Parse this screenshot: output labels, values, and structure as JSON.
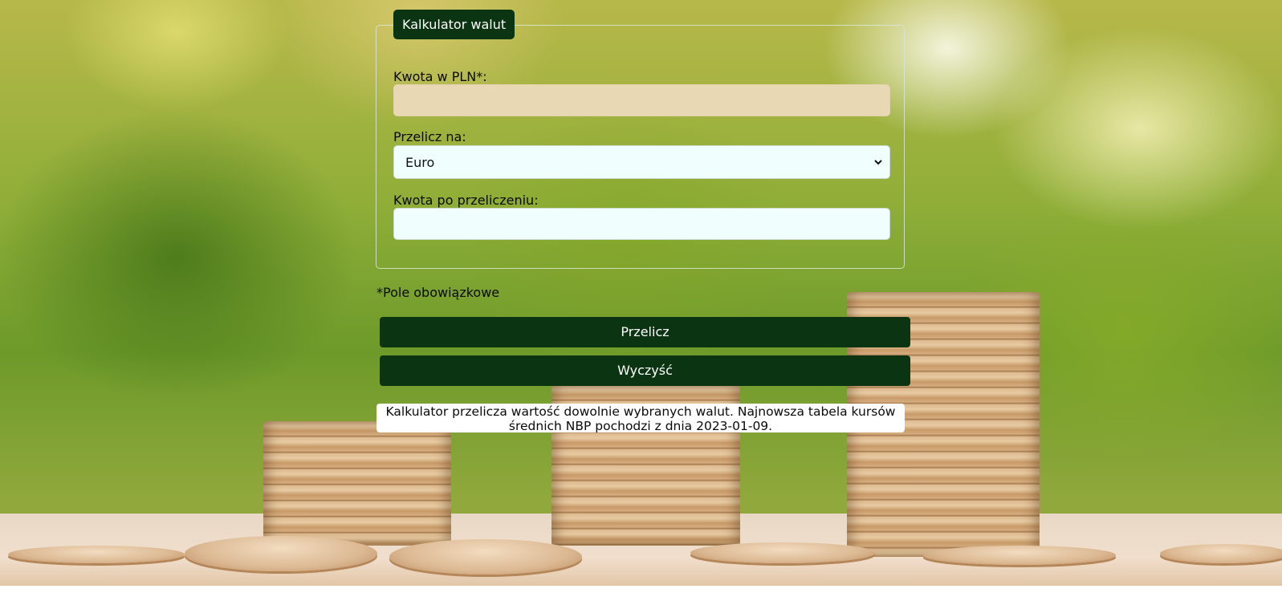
{
  "form": {
    "legend": "Kalkulator walut",
    "amount_label": "Kwota w PLN*:",
    "amount_value": "",
    "target_label": "Przelicz na:",
    "target_selected": "Euro",
    "result_label": "Kwota po przeliczeniu:",
    "result_value": ""
  },
  "required_note": "*Pole obowiązkowe",
  "buttons": {
    "convert": "Przelicz",
    "clear": "Wyczyść"
  },
  "info": {
    "line1": "Kalkulator przelicza wartość dowolnie wybranych walut. Najnowsza tabela kursów",
    "line2": "średnich NBP pochodzi z dnia 2023-01-09."
  },
  "icons": {
    "select_arrow": "chevron-down-icon"
  },
  "colors": {
    "accent": "#0b3512",
    "amount_field": "#e8d8b4",
    "field_bg": "#f0fffe"
  }
}
